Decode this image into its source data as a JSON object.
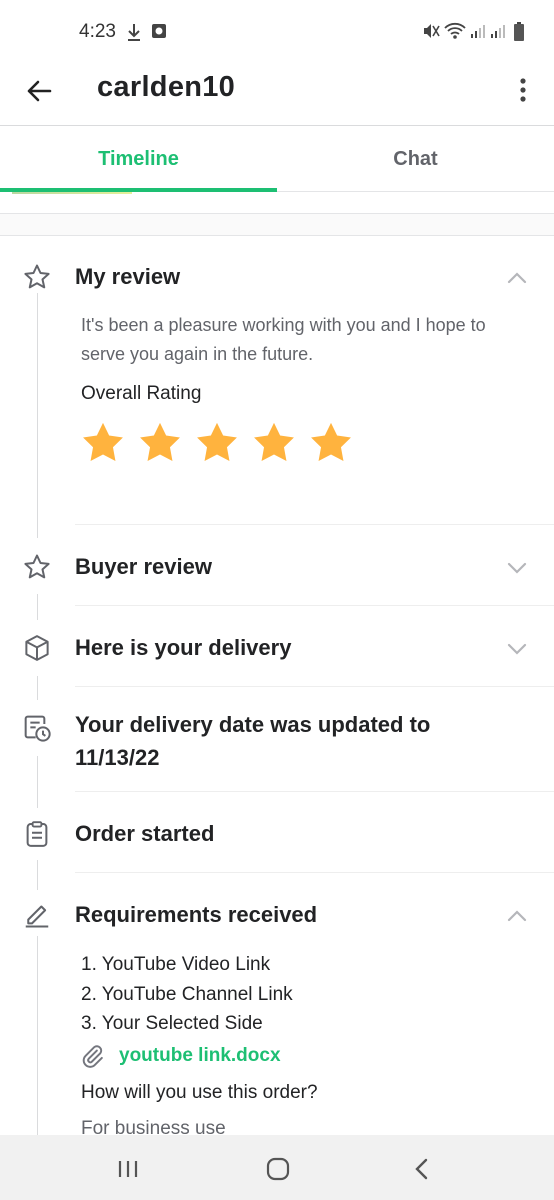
{
  "status_bar": {
    "time": "4:23"
  },
  "header": {
    "title": "carlden10"
  },
  "tabs": [
    {
      "label": "Timeline",
      "active": true
    },
    {
      "label": "Chat",
      "active": false
    }
  ],
  "timeline": {
    "my_review": {
      "title": "My review",
      "text": "It's been a pleasure working with you and I hope to serve you again in the future.",
      "rating_label": "Overall Rating",
      "rating": 5,
      "rating_max": 5
    },
    "buyer_review": {
      "title": "Buyer review"
    },
    "delivery": {
      "title": "Here is your delivery"
    },
    "date_update": {
      "title_line1": "Your delivery date was updated to",
      "title_line2": "11/13/22"
    },
    "order_started": {
      "title": "Order started"
    },
    "requirements": {
      "title": "Requirements received",
      "items": [
        "1. YouTube Video Link",
        "2. YouTube Channel Link",
        "3. Your Selected Side"
      ],
      "attachment": "youtube link.docx",
      "question": "How will you use this order?",
      "answer": "For business use"
    }
  },
  "colors": {
    "accent": "#1dbf73",
    "star": "#ffb33e",
    "text": "#222325",
    "muted": "#62646a"
  },
  "icons": [
    "back-arrow-icon",
    "more-vert-icon",
    "star-outline-icon",
    "chevron-up-icon",
    "chevron-down-icon",
    "box-icon",
    "calendar-clock-icon",
    "clipboard-icon",
    "pencil-icon",
    "paperclip-icon"
  ]
}
